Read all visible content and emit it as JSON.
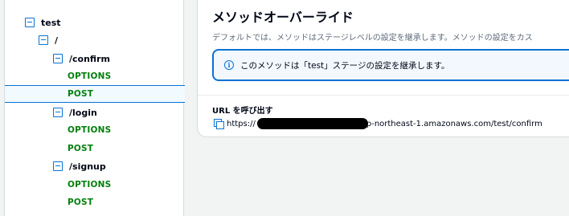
{
  "tree": {
    "items": [
      {
        "type": "resource",
        "label": "test"
      },
      {
        "type": "resource",
        "label": "/"
      },
      {
        "type": "resource",
        "label": "/confirm"
      },
      {
        "type": "method",
        "label": "OPTIONS"
      },
      {
        "type": "method",
        "label": "POST",
        "selected": true
      },
      {
        "type": "resource",
        "label": "/login"
      },
      {
        "type": "method",
        "label": "OPTIONS"
      },
      {
        "type": "method",
        "label": "POST"
      },
      {
        "type": "resource",
        "label": "/signup"
      },
      {
        "type": "method",
        "label": "OPTIONS"
      },
      {
        "type": "method",
        "label": "POST"
      }
    ]
  },
  "main": {
    "title": "メソッドオーバーライド",
    "description": "デフォルトでは、メソッドはステージレベルの設定を継承します。メソッドの設定をカス",
    "info_alert": {
      "icon": "info-icon",
      "text": "このメソッドは「test」ステージの設定を継承します。"
    },
    "invoke_url": {
      "label": "URL を呼び出す",
      "prefix": "https://",
      "suffix": "p-northeast-1.amazonaws.com/test/confirm",
      "icon": "copy-icon"
    }
  },
  "colors": {
    "accent": "#0972d3",
    "method_green": "#037f0c",
    "selected_bg": "#f1faff",
    "alert_bg": "#f2f8fd"
  }
}
